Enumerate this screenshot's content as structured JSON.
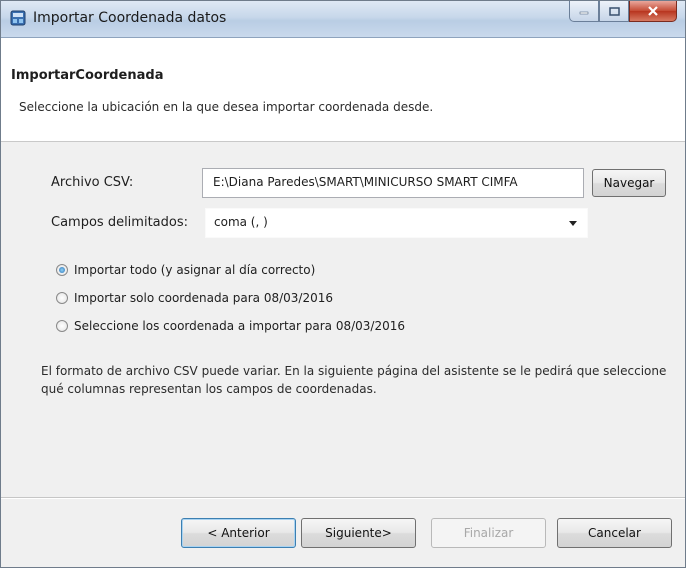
{
  "window": {
    "title": "Importar Coordenada datos",
    "title_icon": "wizard-app-icon",
    "controls": {
      "minimize": "minimize-icon",
      "maximize": "maximize-icon",
      "close": "close-icon"
    }
  },
  "header": {
    "title": "ImportarCoordenada",
    "description": "Seleccione la ubicación en la que desea importar coordenada desde."
  },
  "form": {
    "csv_label": "Archivo CSV:",
    "csv_value": "E:\\Diana Paredes\\SMART\\MINICURSO SMART CIMFA",
    "browse_label": "Navegar",
    "delimiter_label": "Campos delimitados:",
    "delimiter_value": "coma (, )",
    "options": [
      {
        "label": "Importar todo (y asignar al día correcto)",
        "checked": true
      },
      {
        "label": "Importar solo coordenada para 08/03/2016",
        "checked": false
      },
      {
        "label": "Seleccione los coordenada a importar para 08/03/2016",
        "checked": false
      }
    ],
    "info": "El formato de archivo CSV puede variar. En la siguiente página del asistente se le pedirá que seleccione qué columnas representan los campos de coordenadas."
  },
  "footer": {
    "back": "< Anterior",
    "next": "Siguiente>",
    "finish": "Finalizar",
    "cancel": "Cancelar"
  },
  "colors": {
    "accent": "#3c7fb1",
    "radio_selected": "#2a73b8",
    "disabled_text": "#a8a8a8"
  }
}
